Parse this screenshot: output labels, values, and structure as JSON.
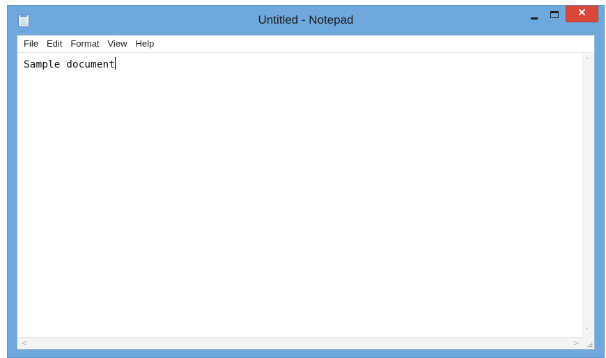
{
  "window": {
    "title": "Untitled - Notepad",
    "icons": {
      "app": "notepad-icon",
      "minimize": "minimize-icon",
      "maximize": "maximize-icon",
      "close": "close-icon"
    },
    "close_glyph": "✕"
  },
  "menubar": {
    "items": [
      {
        "label": "File"
      },
      {
        "label": "Edit"
      },
      {
        "label": "Format"
      },
      {
        "label": "View"
      },
      {
        "label": "Help"
      }
    ]
  },
  "editor": {
    "content": "Sample document"
  },
  "scrollbars": {
    "up_arrow": "˄",
    "down_arrow": "˅",
    "left_arrow": "<",
    "right_arrow": ">"
  },
  "colors": {
    "titlebar": "#6fa8dc",
    "close_button": "#d9463a"
  }
}
